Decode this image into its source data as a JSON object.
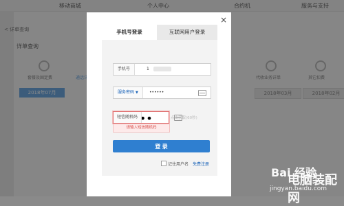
{
  "background": {
    "nav_items": [
      "移动商城",
      "个人中心",
      "合约机",
      "服务与支持"
    ],
    "breadcrumb": "< 详单查询",
    "section_title": "详单查询",
    "tabs": [
      "套餐及固定费",
      "通话详单",
      "代收业务详单",
      "其它扣费"
    ],
    "months": [
      "2018年07月",
      "2018年03月",
      "2018年02月"
    ]
  },
  "modal": {
    "close_label": "×",
    "tabs": {
      "phone": "手机号登录",
      "internet": "互联网用户登录"
    },
    "phone_field": {
      "label": "手机号",
      "value": "1"
    },
    "password_field": {
      "label": "服务密码",
      "value": "••••••"
    },
    "captcha_field": {
      "label": "短信随机码",
      "value": "••••••"
    },
    "get_code_label": "点击获取(60秒)",
    "error_message": "请输入短信随机码",
    "login_button": "登 录",
    "remember_label": "记住用户名",
    "register_link": "免费注册"
  },
  "watermark": {
    "logo": "Bai 经验",
    "sub": "jingyan.baidu.com",
    "site": "电脑装配网"
  },
  "colors": {
    "accent": "#2f7fd0",
    "error": "#d9534f",
    "overlay": "rgba(0,0,0,0.45)"
  }
}
